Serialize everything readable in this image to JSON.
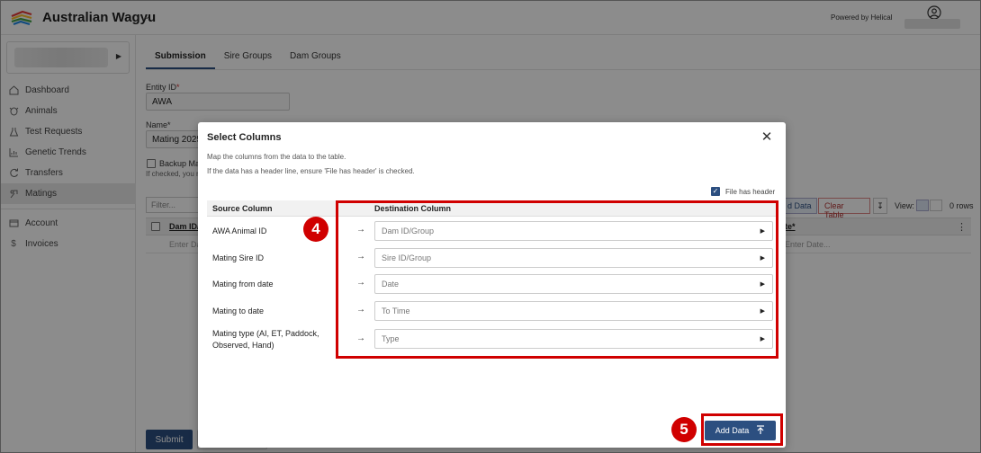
{
  "topbar": {
    "app_title": "Australian Wagyu",
    "powered_by": "Powered by Helical"
  },
  "sidebar": {
    "items": [
      {
        "label": "Dashboard",
        "icon": "home-icon"
      },
      {
        "label": "Animals",
        "icon": "cow-icon"
      },
      {
        "label": "Test Requests",
        "icon": "flask-icon"
      },
      {
        "label": "Genetic Trends",
        "icon": "chart-icon"
      },
      {
        "label": "Transfers",
        "icon": "transfer-icon"
      },
      {
        "label": "Matings",
        "icon": "mating-icon",
        "active": true
      }
    ],
    "secondary": [
      {
        "label": "Account",
        "icon": "account-icon"
      },
      {
        "label": "Invoices",
        "icon": "dollar-icon"
      }
    ]
  },
  "main": {
    "tabs": [
      {
        "label": "Submission",
        "active": true
      },
      {
        "label": "Sire Groups",
        "active": false
      },
      {
        "label": "Dam Groups",
        "active": false
      }
    ],
    "entity_id_label": "Entity ID",
    "entity_id_value": "AWA",
    "name_label": "Name",
    "name_value": "Mating 2025",
    "backup_label": "Backup Ma",
    "backup_note": "If checked, you r",
    "filter_placeholder": "Filter...",
    "grid_col_1": "Dam ID/",
    "grid_col_2": "te*",
    "grid_row_placeholder_1": "Enter Da",
    "grid_row_placeholder_2": "Enter Date...",
    "add_data_partial": "d Data",
    "clear_table": "Clear Table",
    "view_label": "View:",
    "rows_label": "0 rows",
    "submit": "Submit"
  },
  "modal": {
    "title": "Select Columns",
    "desc1": "Map the columns from the data to the table.",
    "desc2": "If the data has a header line, ensure 'File has header' is checked.",
    "file_has_header_label": "File has header",
    "file_has_header_checked": true,
    "source_column_header": "Source Column",
    "destination_column_header": "Destination Column",
    "rows": [
      {
        "source": "AWA Animal ID",
        "destination": "Dam ID/Group"
      },
      {
        "source": "Mating Sire ID",
        "destination": "Sire ID/Group"
      },
      {
        "source": "Mating from date",
        "destination": "Date"
      },
      {
        "source": "Mating to date",
        "destination": "To Time"
      },
      {
        "source": "Mating type (AI, ET, Paddock, Observed, Hand)",
        "destination": "Type"
      }
    ],
    "add_data_button": "Add Data"
  },
  "annotations": {
    "step4": "4",
    "step5": "5",
    "color": "#d00000"
  },
  "colors": {
    "primary": "#2c4f80",
    "danger": "#b03030"
  }
}
